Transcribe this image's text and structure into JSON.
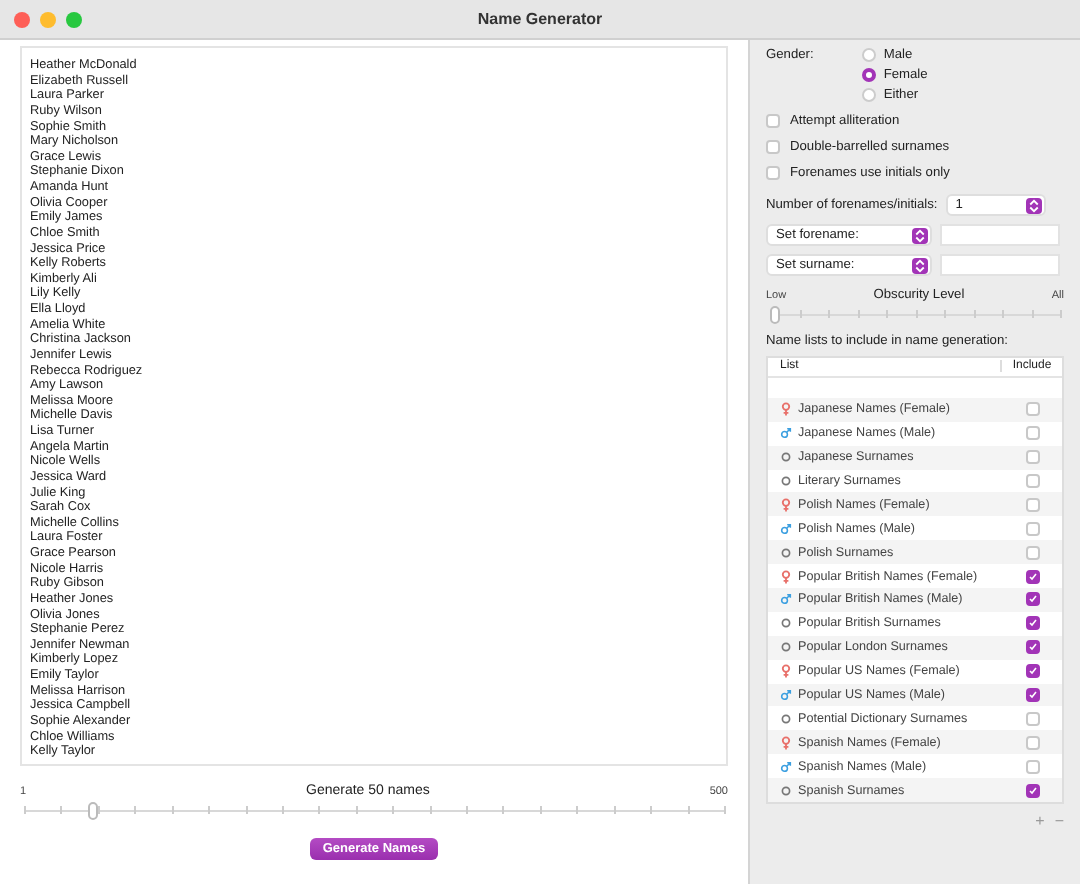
{
  "window": {
    "title": "Name Generator"
  },
  "names": [
    "Heather McDonald",
    "Elizabeth Russell",
    "Laura Parker",
    "Ruby Wilson",
    "Sophie Smith",
    "Mary Nicholson",
    "Grace Lewis",
    "Stephanie Dixon",
    "Amanda Hunt",
    "Olivia Cooper",
    "Emily James",
    "Chloe Smith",
    "Jessica Price",
    "Kelly Roberts",
    "Kimberly Ali",
    "Lily Kelly",
    "Ella Lloyd",
    "Amelia White",
    "Christina Jackson",
    "Jennifer Lewis",
    "Rebecca Rodriguez",
    "Amy Lawson",
    "Melissa Moore",
    "Michelle Davis",
    "Lisa Turner",
    "Angela Martin",
    "Nicole Wells",
    "Jessica Ward",
    "Julie King",
    "Sarah Cox",
    "Michelle Collins",
    "Laura Foster",
    "Grace Pearson",
    "Nicole Harris",
    "Ruby Gibson",
    "Heather Jones",
    "Olivia Jones",
    "Stephanie Perez",
    "Jennifer Newman",
    "Kimberly Lopez",
    "Emily Taylor",
    "Melissa Harrison",
    "Jessica Campbell",
    "Sophie Alexander",
    "Chloe Williams",
    "Kelly Taylor"
  ],
  "count_slider": {
    "min_label": "1",
    "label": "Generate 50 names",
    "max_label": "500",
    "level": 0.1
  },
  "generate_button": "Generate Names",
  "gender": {
    "label": "Gender:",
    "options": [
      {
        "label": "Male",
        "selected": false
      },
      {
        "label": "Female",
        "selected": true
      },
      {
        "label": "Either",
        "selected": false
      }
    ]
  },
  "checkboxes": [
    {
      "label": "Attempt alliteration",
      "checked": false
    },
    {
      "label": "Double-barrelled surnames",
      "checked": false
    },
    {
      "label": "Forenames use initials only",
      "checked": false
    }
  ],
  "forename_count": {
    "label": "Number of forenames/initials:",
    "value": "1"
  },
  "set_forename": {
    "label": "Set forename:"
  },
  "set_surname": {
    "label": "Set surname:"
  },
  "obscurity": {
    "label": "Obscurity Level",
    "min_label": "Low",
    "max_label": "All",
    "level": 0
  },
  "lists_label": "Name lists to include in name generation:",
  "table": {
    "columns": [
      "List",
      "Include"
    ],
    "rows": [
      {
        "kind": "female",
        "name": "Japanese Names (Female)",
        "checked": false
      },
      {
        "kind": "male",
        "name": "Japanese Names (Male)",
        "checked": false
      },
      {
        "kind": "surname",
        "name": "Japanese Surnames",
        "checked": false
      },
      {
        "kind": "surname",
        "name": "Literary Surnames",
        "checked": false
      },
      {
        "kind": "female",
        "name": "Polish Names (Female)",
        "checked": false
      },
      {
        "kind": "male",
        "name": "Polish Names (Male)",
        "checked": false
      },
      {
        "kind": "surname",
        "name": "Polish Surnames",
        "checked": false
      },
      {
        "kind": "female",
        "name": "Popular British Names (Female)",
        "checked": true
      },
      {
        "kind": "male",
        "name": "Popular British Names (Male)",
        "checked": true
      },
      {
        "kind": "surname",
        "name": "Popular British Surnames",
        "checked": true
      },
      {
        "kind": "surname",
        "name": "Popular London Surnames",
        "checked": true
      },
      {
        "kind": "female",
        "name": "Popular US Names (Female)",
        "checked": true
      },
      {
        "kind": "male",
        "name": "Popular US Names (Male)",
        "checked": true
      },
      {
        "kind": "surname",
        "name": "Potential Dictionary Surnames",
        "checked": false
      },
      {
        "kind": "female",
        "name": "Spanish Names (Female)",
        "checked": false
      },
      {
        "kind": "male",
        "name": "Spanish Names (Male)",
        "checked": false
      },
      {
        "kind": "surname",
        "name": "Spanish Surnames",
        "checked": true
      }
    ]
  },
  "footer_buttons": [
    "+",
    "−"
  ]
}
